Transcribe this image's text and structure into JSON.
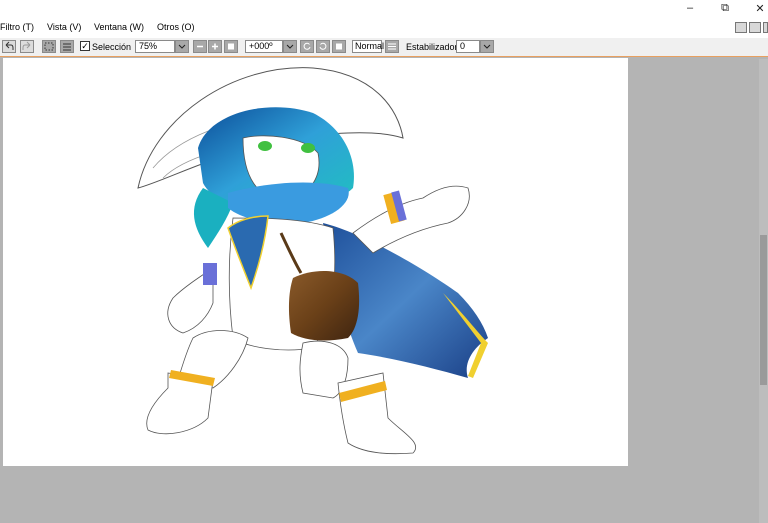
{
  "menu": {
    "items": [
      "Filtro (T)",
      "Vista (V)",
      "Ventana (W)",
      "Otros (O)"
    ]
  },
  "window_controls": {
    "minimize": "–",
    "restore": "⧉",
    "close": "✕"
  },
  "toolbar": {
    "selection_label": "Selección",
    "selection_checked": "✓",
    "zoom_value": "75%",
    "rotation_value": "+000º",
    "blend_mode": "Normal",
    "stabilizer_label": "Estabilizador",
    "stabilizer_value": "0"
  },
  "colors": {
    "workspace": "#b4b4b4",
    "canvas": "#ffffff",
    "accent_border": "#e8a060"
  },
  "artwork": {
    "subject": "character-illustration"
  }
}
